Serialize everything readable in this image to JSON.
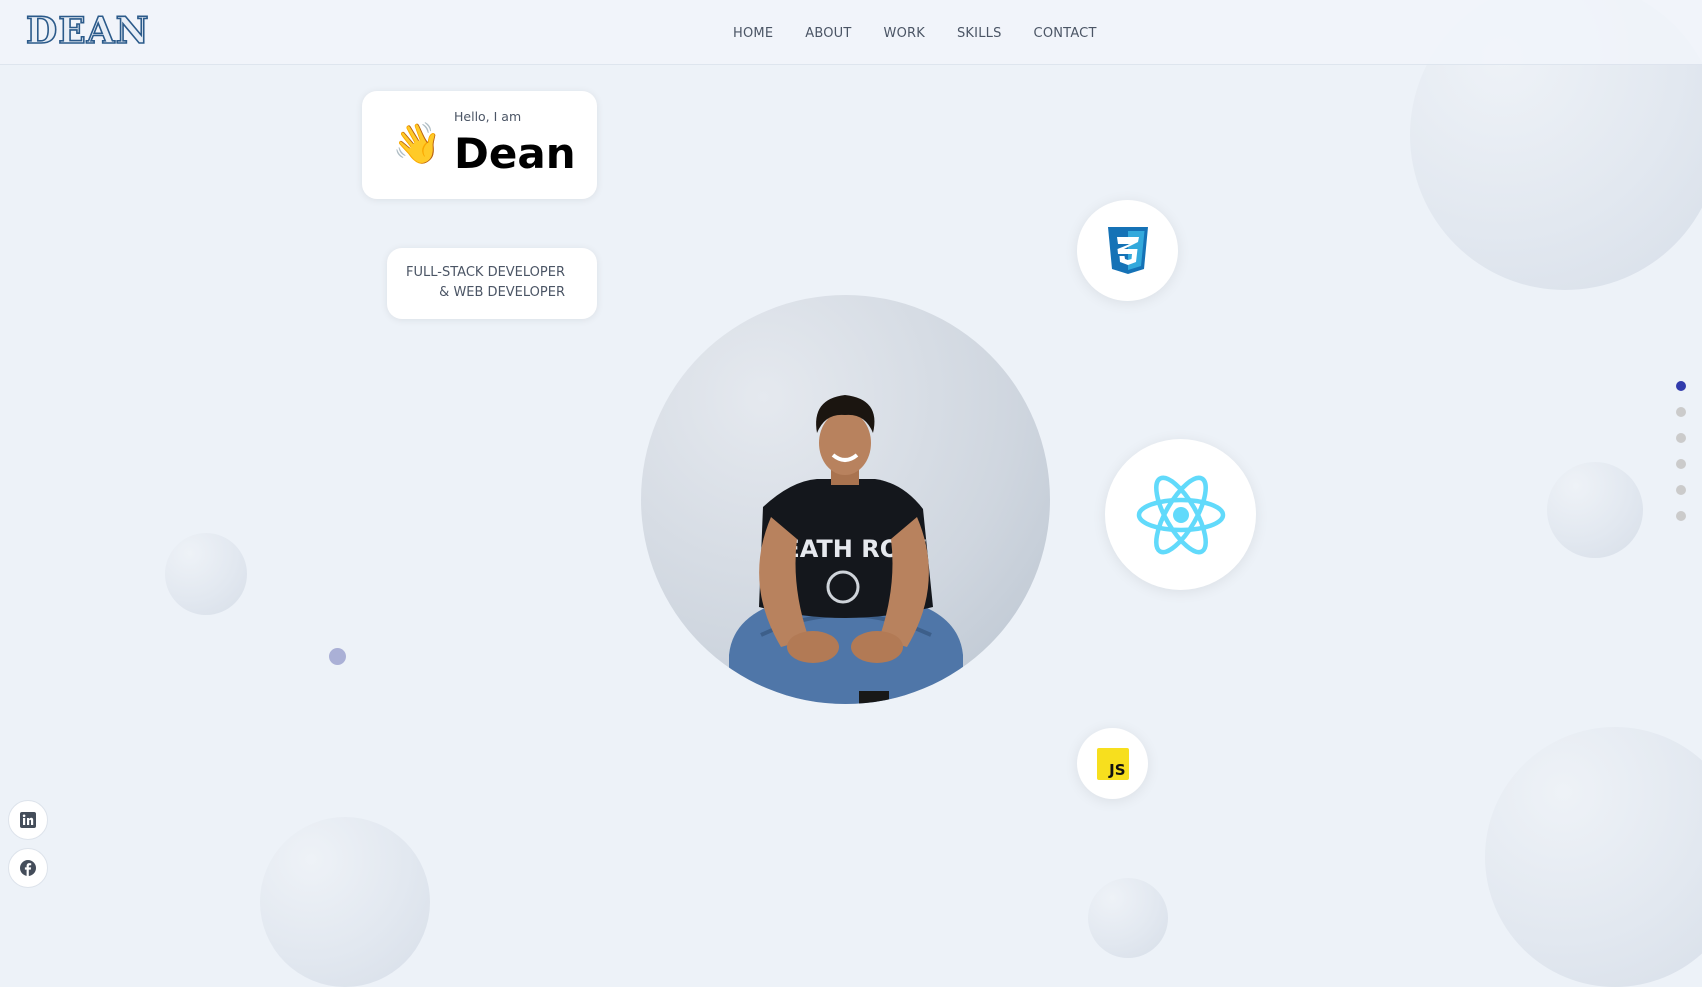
{
  "brand": {
    "logo": "DEAN"
  },
  "nav": {
    "links": [
      "HOME",
      "ABOUT",
      "WORK",
      "SKILLS",
      "CONTACT"
    ]
  },
  "hero": {
    "greeting": "Hello, I am",
    "name": "Dean",
    "wave_emoji": "👋",
    "role_line1": "FULL-STACK DEVELOPER",
    "role_line2": "& WEB DEVELOPER",
    "profile_shirt_text": "DEATH ROW"
  },
  "skills": {
    "icons": [
      "css3-icon",
      "react-icon",
      "javascript-icon"
    ],
    "js_label": "JS"
  },
  "section_dots": {
    "count": 6,
    "active_index": 0
  },
  "social": {
    "icons": [
      "linkedin-icon",
      "facebook-icon"
    ]
  },
  "colors": {
    "accent": "#313bac",
    "background": "#edf2f8",
    "css3": "#1572b6",
    "react": "#61dafb",
    "javascript": "#f7df1e"
  }
}
